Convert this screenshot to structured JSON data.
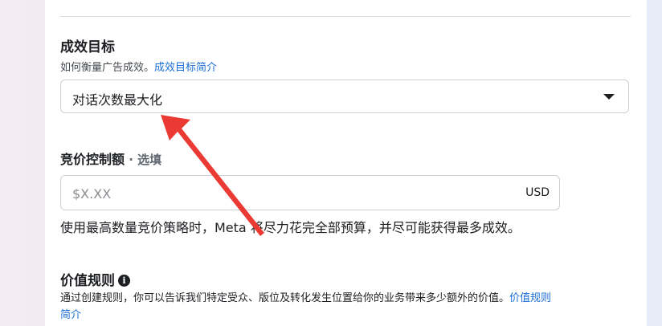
{
  "goal_section": {
    "title": "成效目标",
    "description": "如何衡量广告成效。",
    "link": "成效目标简介",
    "selected_value": "对话次数最大化"
  },
  "bid_section": {
    "title": "竞价控制额",
    "optional": " · 选填",
    "placeholder": "$X.XX",
    "currency": "USD",
    "help": "使用最高数量竞价策略时，Meta 将尽力花完全部预算，并尽可能获得最多成效。"
  },
  "value_rules": {
    "title": "价值规则",
    "info_icon": "i",
    "description": "通过创建规则，你可以告诉我们特定受众、版位及转化发生位置给你的业务带来多少额外的价值。",
    "link_line1": "价值规则",
    "link_line2": "简介"
  },
  "colors": {
    "arrow": "#ea3a33",
    "link": "#1a6ed8"
  }
}
